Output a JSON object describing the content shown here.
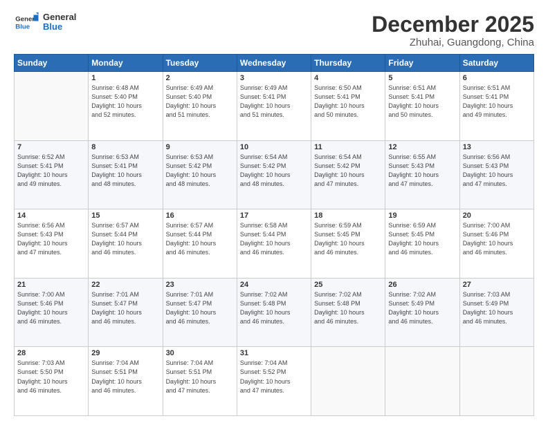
{
  "logo": {
    "general": "General",
    "blue": "Blue"
  },
  "title": "December 2025",
  "location": "Zhuhai, Guangdong, China",
  "days_header": [
    "Sunday",
    "Monday",
    "Tuesday",
    "Wednesday",
    "Thursday",
    "Friday",
    "Saturday"
  ],
  "weeks": [
    [
      {
        "day": "",
        "text": ""
      },
      {
        "day": "1",
        "text": "Sunrise: 6:48 AM\nSunset: 5:40 PM\nDaylight: 10 hours\nand 52 minutes."
      },
      {
        "day": "2",
        "text": "Sunrise: 6:49 AM\nSunset: 5:40 PM\nDaylight: 10 hours\nand 51 minutes."
      },
      {
        "day": "3",
        "text": "Sunrise: 6:49 AM\nSunset: 5:41 PM\nDaylight: 10 hours\nand 51 minutes."
      },
      {
        "day": "4",
        "text": "Sunrise: 6:50 AM\nSunset: 5:41 PM\nDaylight: 10 hours\nand 50 minutes."
      },
      {
        "day": "5",
        "text": "Sunrise: 6:51 AM\nSunset: 5:41 PM\nDaylight: 10 hours\nand 50 minutes."
      },
      {
        "day": "6",
        "text": "Sunrise: 6:51 AM\nSunset: 5:41 PM\nDaylight: 10 hours\nand 49 minutes."
      }
    ],
    [
      {
        "day": "7",
        "text": "Sunrise: 6:52 AM\nSunset: 5:41 PM\nDaylight: 10 hours\nand 49 minutes."
      },
      {
        "day": "8",
        "text": "Sunrise: 6:53 AM\nSunset: 5:41 PM\nDaylight: 10 hours\nand 48 minutes."
      },
      {
        "day": "9",
        "text": "Sunrise: 6:53 AM\nSunset: 5:42 PM\nDaylight: 10 hours\nand 48 minutes."
      },
      {
        "day": "10",
        "text": "Sunrise: 6:54 AM\nSunset: 5:42 PM\nDaylight: 10 hours\nand 48 minutes."
      },
      {
        "day": "11",
        "text": "Sunrise: 6:54 AM\nSunset: 5:42 PM\nDaylight: 10 hours\nand 47 minutes."
      },
      {
        "day": "12",
        "text": "Sunrise: 6:55 AM\nSunset: 5:43 PM\nDaylight: 10 hours\nand 47 minutes."
      },
      {
        "day": "13",
        "text": "Sunrise: 6:56 AM\nSunset: 5:43 PM\nDaylight: 10 hours\nand 47 minutes."
      }
    ],
    [
      {
        "day": "14",
        "text": "Sunrise: 6:56 AM\nSunset: 5:43 PM\nDaylight: 10 hours\nand 47 minutes."
      },
      {
        "day": "15",
        "text": "Sunrise: 6:57 AM\nSunset: 5:44 PM\nDaylight: 10 hours\nand 46 minutes."
      },
      {
        "day": "16",
        "text": "Sunrise: 6:57 AM\nSunset: 5:44 PM\nDaylight: 10 hours\nand 46 minutes."
      },
      {
        "day": "17",
        "text": "Sunrise: 6:58 AM\nSunset: 5:44 PM\nDaylight: 10 hours\nand 46 minutes."
      },
      {
        "day": "18",
        "text": "Sunrise: 6:59 AM\nSunset: 5:45 PM\nDaylight: 10 hours\nand 46 minutes."
      },
      {
        "day": "19",
        "text": "Sunrise: 6:59 AM\nSunset: 5:45 PM\nDaylight: 10 hours\nand 46 minutes."
      },
      {
        "day": "20",
        "text": "Sunrise: 7:00 AM\nSunset: 5:46 PM\nDaylight: 10 hours\nand 46 minutes."
      }
    ],
    [
      {
        "day": "21",
        "text": "Sunrise: 7:00 AM\nSunset: 5:46 PM\nDaylight: 10 hours\nand 46 minutes."
      },
      {
        "day": "22",
        "text": "Sunrise: 7:01 AM\nSunset: 5:47 PM\nDaylight: 10 hours\nand 46 minutes."
      },
      {
        "day": "23",
        "text": "Sunrise: 7:01 AM\nSunset: 5:47 PM\nDaylight: 10 hours\nand 46 minutes."
      },
      {
        "day": "24",
        "text": "Sunrise: 7:02 AM\nSunset: 5:48 PM\nDaylight: 10 hours\nand 46 minutes."
      },
      {
        "day": "25",
        "text": "Sunrise: 7:02 AM\nSunset: 5:48 PM\nDaylight: 10 hours\nand 46 minutes."
      },
      {
        "day": "26",
        "text": "Sunrise: 7:02 AM\nSunset: 5:49 PM\nDaylight: 10 hours\nand 46 minutes."
      },
      {
        "day": "27",
        "text": "Sunrise: 7:03 AM\nSunset: 5:49 PM\nDaylight: 10 hours\nand 46 minutes."
      }
    ],
    [
      {
        "day": "28",
        "text": "Sunrise: 7:03 AM\nSunset: 5:50 PM\nDaylight: 10 hours\nand 46 minutes."
      },
      {
        "day": "29",
        "text": "Sunrise: 7:04 AM\nSunset: 5:51 PM\nDaylight: 10 hours\nand 46 minutes."
      },
      {
        "day": "30",
        "text": "Sunrise: 7:04 AM\nSunset: 5:51 PM\nDaylight: 10 hours\nand 47 minutes."
      },
      {
        "day": "31",
        "text": "Sunrise: 7:04 AM\nSunset: 5:52 PM\nDaylight: 10 hours\nand 47 minutes."
      },
      {
        "day": "",
        "text": ""
      },
      {
        "day": "",
        "text": ""
      },
      {
        "day": "",
        "text": ""
      }
    ]
  ]
}
